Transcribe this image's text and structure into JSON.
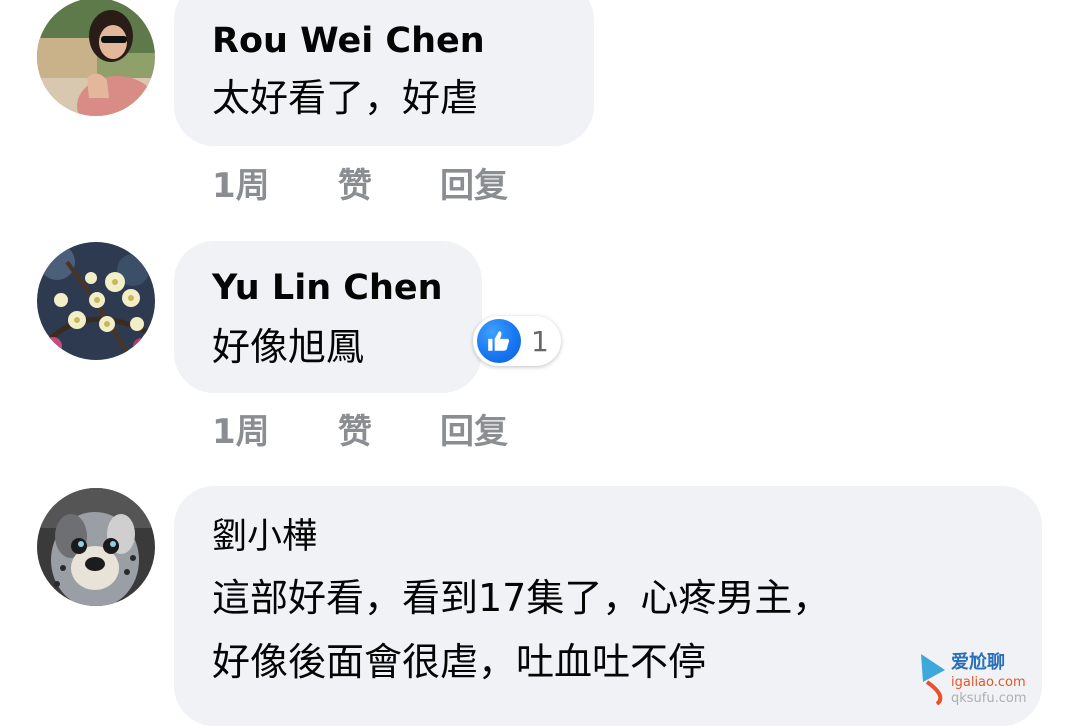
{
  "comments": [
    {
      "author": "Rou Wei Chen",
      "text": [
        "太好看了，好虐"
      ],
      "time": "1周",
      "like_label": "赞",
      "reply_label": "回复",
      "reactions": null
    },
    {
      "author": "Yu Lin Chen",
      "text": [
        "好像旭鳳"
      ],
      "time": "1周",
      "like_label": "赞",
      "reply_label": "回复",
      "reactions": {
        "icon": "thumbs-up-icon",
        "count": "1"
      }
    },
    {
      "author": "劉小樺",
      "text": [
        "這部好看，看到17集了，心疼男主，",
        "好像後面會很虐，吐血吐不停"
      ],
      "reactions": null
    }
  ],
  "watermark": {
    "line1": "爱尬聊",
    "line2": "igaliao.com",
    "line3": "qksufu.com"
  },
  "colors": {
    "bubble": "#f0f2f5",
    "meta_text": "#8a8d91",
    "like_blue": "#1877f2"
  }
}
